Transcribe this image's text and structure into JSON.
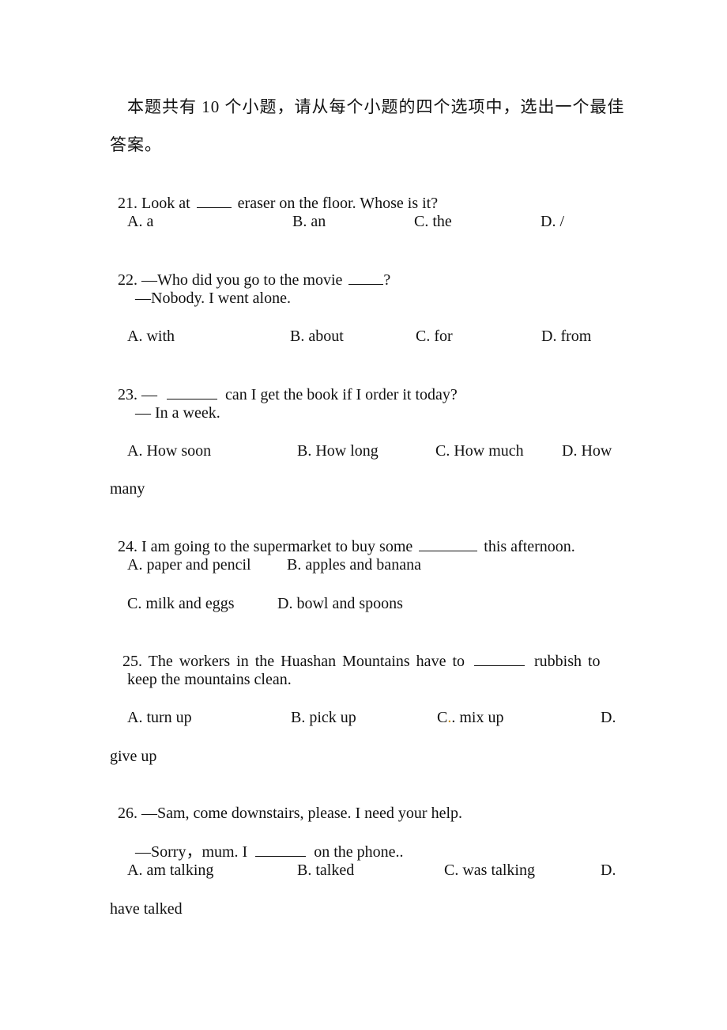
{
  "instructions": {
    "line1": "本题共有 10 个小题，请从每个小题的四个选项中，选出一个最佳",
    "line2": "答案。"
  },
  "questions": [
    {
      "number": "21.",
      "stem_before": "Look at",
      "stem_after": "eraser on the floor. Whose is it?",
      "options": [
        "A. a",
        "B. an",
        "C. the",
        "D. /"
      ]
    },
    {
      "number": "22.",
      "stem_before": "—Who did you go to the movie",
      "stem_after": "?",
      "reply": "—Nobody. I went alone.",
      "options": [
        "A. with",
        "B. about",
        "C. for",
        "D. from"
      ]
    },
    {
      "number": "23.",
      "stem_before": "—",
      "stem_after": "can I get the book if I order it today?",
      "reply": "— In a week.",
      "options": [
        "A. How soon",
        "B. How long",
        "C. How much",
        "D. How"
      ],
      "option_wrap": "many"
    },
    {
      "number": "24.",
      "stem_before": "I am going to the supermarket to buy some",
      "stem_after": "this afternoon.",
      "options": [
        "A. paper and pencil",
        "B. apples and banana",
        "C. milk and eggs",
        "D. bowl and spoons"
      ]
    },
    {
      "number": "25.",
      "stem_before": "The workers in the Huashan Mountains have to",
      "stem_after": "rubbish to",
      "stem_cont": "keep the mountains clean.",
      "options": [
        "A. turn up",
        "B. pick up",
        "C",
        ". mix up",
        "D."
      ],
      "option_wrap": "give up"
    },
    {
      "number": "26.",
      "stem_before": "—Sam, come downstairs, please. I need your help.",
      "reply_before": "—Sorry，mum. I",
      "reply_after": "on the phone..",
      "options": [
        "A. am talking",
        "B. talked",
        "C. was talking",
        "D."
      ],
      "option_wrap": "have talked"
    }
  ]
}
